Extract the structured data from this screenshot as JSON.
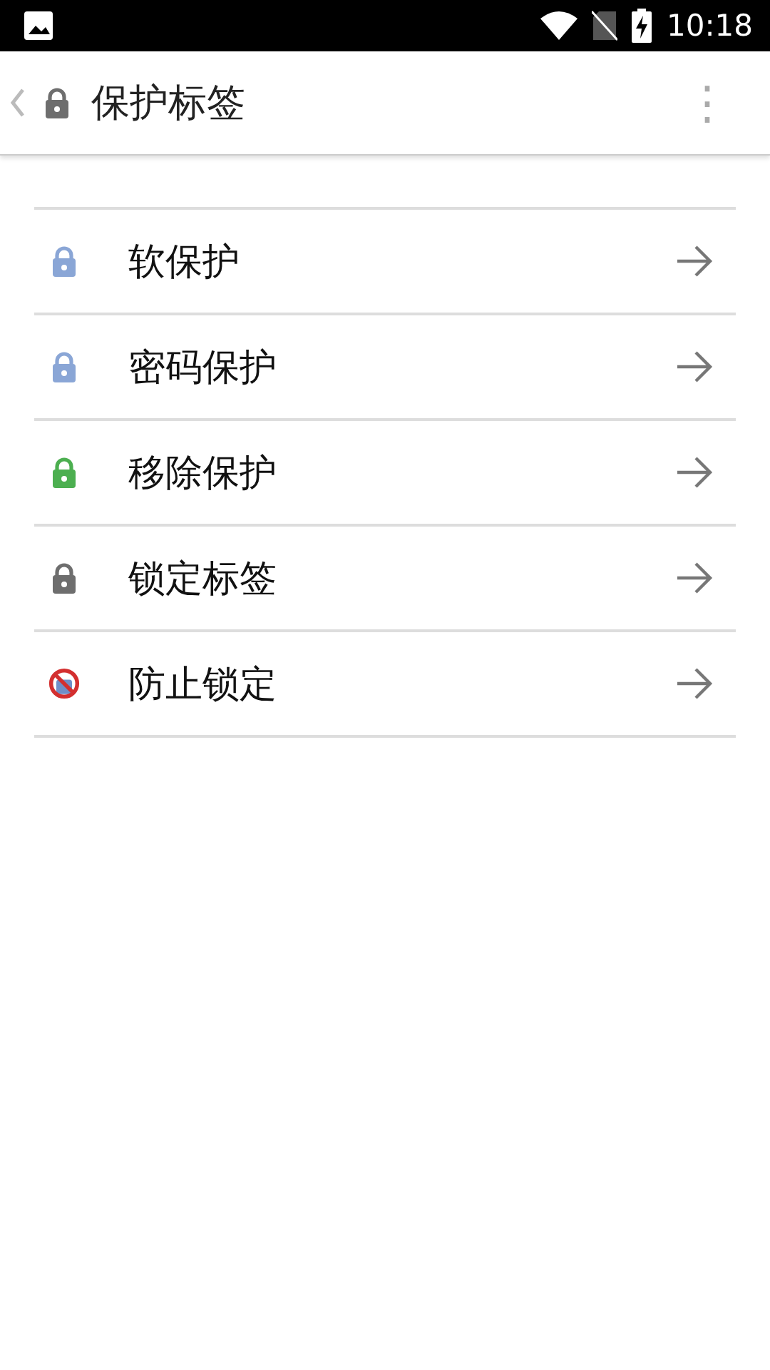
{
  "status_bar": {
    "time": "10:18"
  },
  "app_bar": {
    "title": "保护标签",
    "menu_icon": "⋮"
  },
  "items": [
    {
      "label": "软保护",
      "kind": "lock",
      "color": "#8aa6d6"
    },
    {
      "label": "密码保护",
      "kind": "lock",
      "color": "#8aa6d6"
    },
    {
      "label": "移除保护",
      "kind": "lock",
      "color": "#4caf50"
    },
    {
      "label": "锁定标签",
      "kind": "lock",
      "color": "#6e6e6e"
    },
    {
      "label": "防止锁定",
      "kind": "forbidden",
      "color": "#d32f2f"
    }
  ]
}
